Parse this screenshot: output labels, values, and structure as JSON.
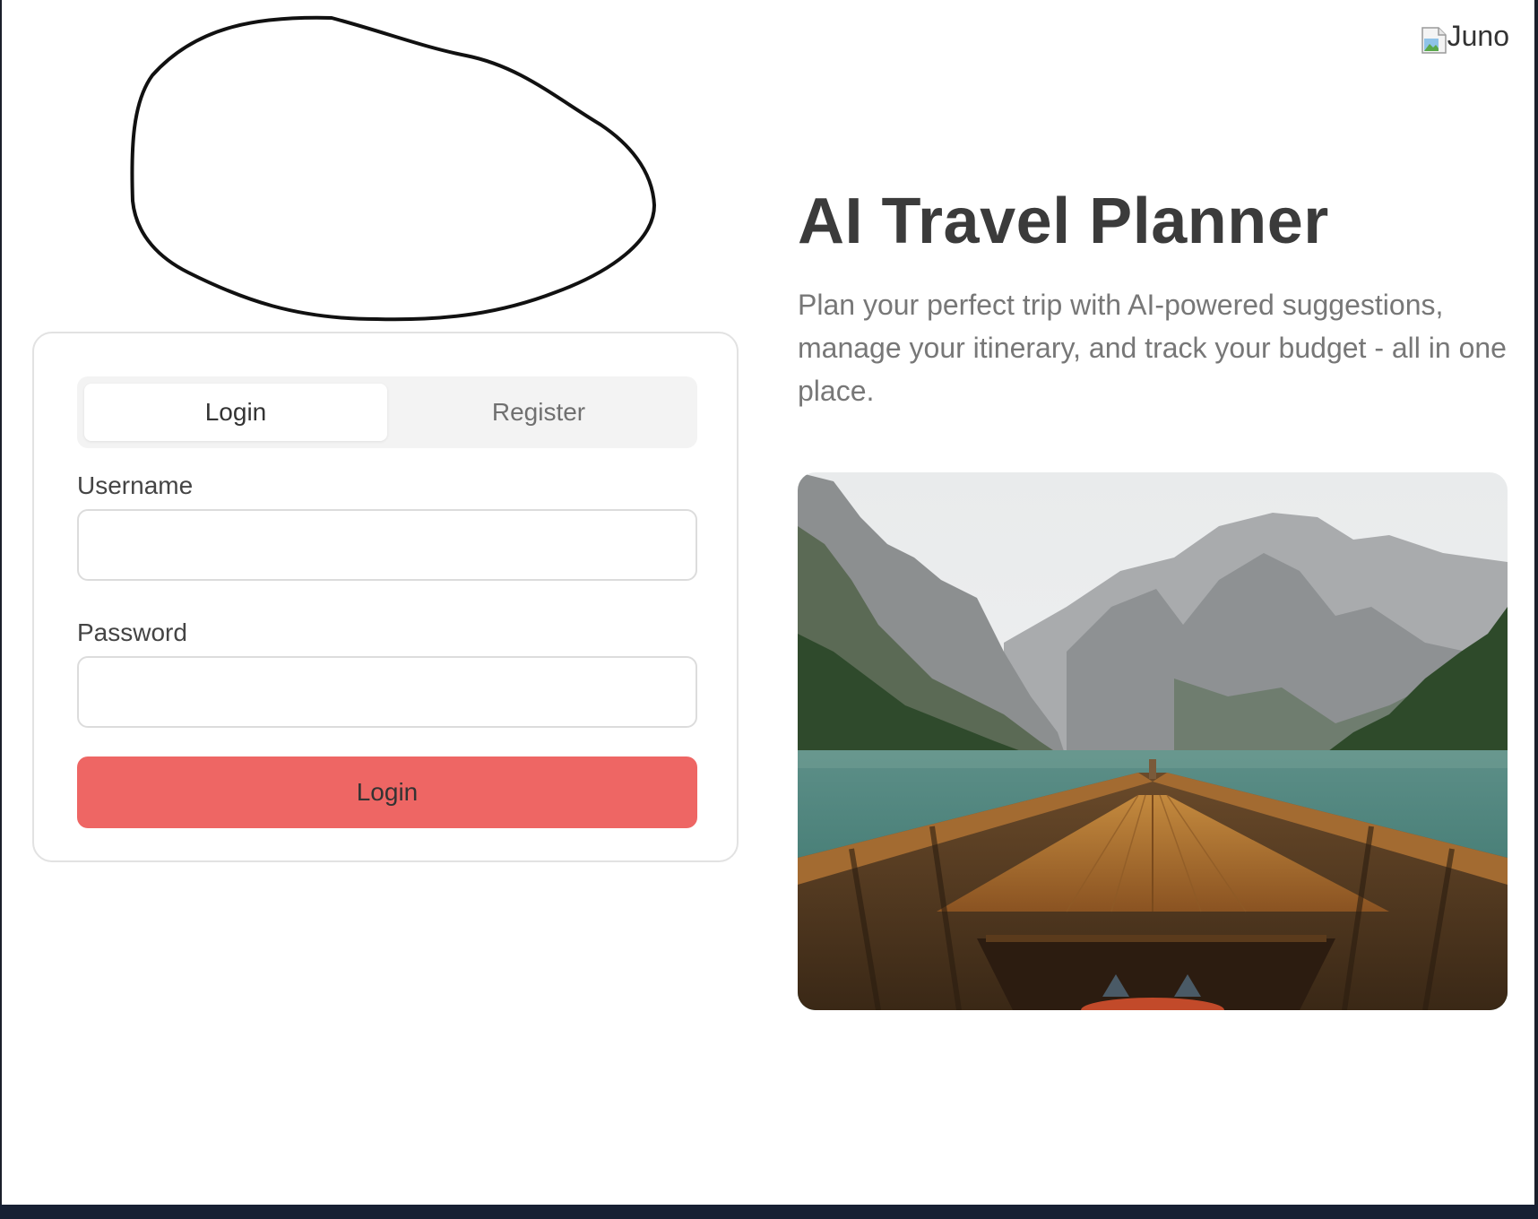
{
  "header": {
    "logo_alt": "Juno",
    "logo_icon": "broken-image-icon"
  },
  "auth": {
    "tabs": [
      {
        "label": "Login",
        "active": true
      },
      {
        "label": "Register",
        "active": false
      }
    ],
    "username_label": "Username",
    "username_value": "",
    "password_label": "Password",
    "password_value": "",
    "submit_label": "Login"
  },
  "hero": {
    "title": "AI Travel Planner",
    "description": "Plan your perfect trip with AI-powered suggestions, manage your itinerary, and track your budget - all in one place."
  },
  "colors": {
    "accent": "#ee6664",
    "frame": "#172033"
  }
}
